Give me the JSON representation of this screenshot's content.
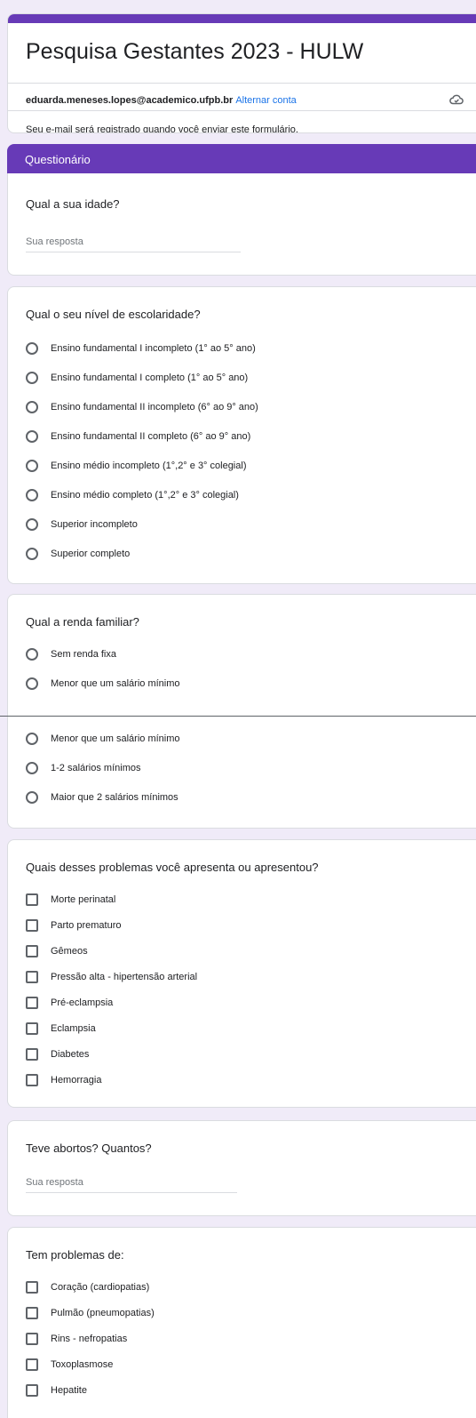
{
  "form": {
    "title": "Pesquisa Gestantes 2023 - HULW",
    "account_email": "eduarda.meneses.lopes@academico.ufpb.br",
    "switch_account": "Alternar conta",
    "email_note": "Seu e-mail será registrado quando você enviar este formulário.",
    "cloud_icon": "cloud-icon",
    "accent_color": "#673ab7",
    "link_color": "#1a73e8"
  },
  "section": {
    "title": "Questionário"
  },
  "q_idade": {
    "label": "Qual a sua idade?",
    "placeholder": "Sua resposta"
  },
  "q_escolaridade": {
    "label": "Qual o seu nível de escolaridade?",
    "options": [
      "Ensino fundamental I incompleto  (1° ao 5° ano)",
      "Ensino fundamental I completo (1° ao 5° ano)",
      "Ensino fundamental II  incompleto (6° ao 9° ano)",
      "Ensino fundamental II completo (6° ao 9° ano)",
      "Ensino médio incompleto (1°,2° e 3° colegial)",
      "Ensino médio completo (1°,2° e 3° colegial)",
      "Superior incompleto",
      "Superior completo"
    ]
  },
  "q_renda": {
    "label": "Qual a renda familiar?",
    "options": [
      "Sem renda fixa",
      "Menor que um salário mínimo",
      "1-2 salários mínimos",
      "Maior que 2 salários mínimos"
    ]
  },
  "q_problemas": {
    "label": "Quais desses problemas você apresenta ou apresentou?",
    "options": [
      "Morte perinatal",
      "Parto prematuro",
      "Gêmeos",
      "Pressão alta - hipertensão arterial",
      "Pré-eclampsia",
      "Eclampsia",
      "Diabetes",
      "Hemorragia"
    ]
  },
  "q_abortos": {
    "label": "Teve abortos? Quantos?",
    "placeholder": "Sua resposta"
  },
  "q_tem_problemas": {
    "label": "Tem problemas de:",
    "options": [
      "Coração (cardiopatias)",
      "Pulmão (pneumopatias)",
      "Rins - nefropatias",
      "Toxoplasmose",
      "Hepatite"
    ]
  }
}
